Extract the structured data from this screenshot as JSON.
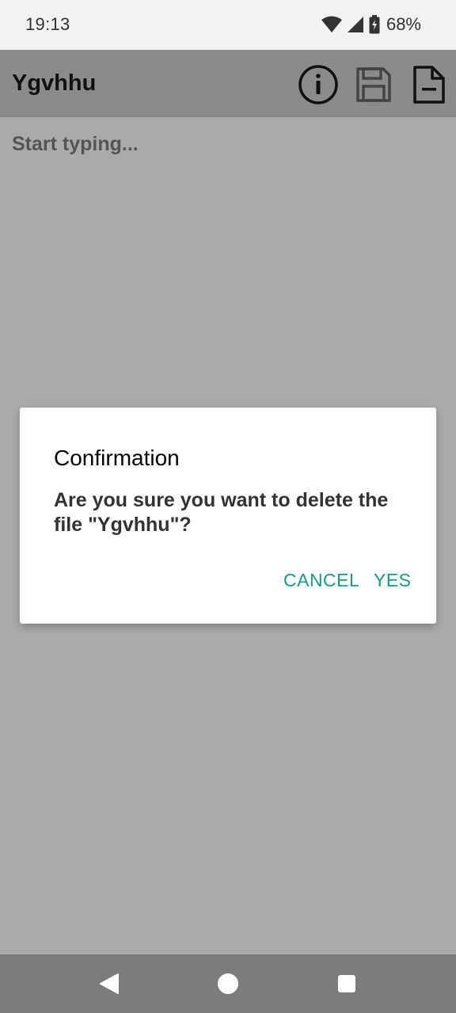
{
  "status_bar": {
    "time": "19:13",
    "battery_percent": "68%",
    "icons": [
      "wifi-icon",
      "signal-icon",
      "battery-charging-icon"
    ]
  },
  "app_bar": {
    "title": "Ygvhhu",
    "actions": [
      "info-icon",
      "save-icon",
      "delete-file-icon"
    ]
  },
  "editor": {
    "placeholder": "Start typing..."
  },
  "dialog": {
    "title": "Confirmation",
    "message": "Are you sure you want to delete the\nfile \"Ygvhhu\"?",
    "cancel_label": "CANCEL",
    "confirm_label": "YES",
    "accent_color": "#1a9986"
  },
  "nav_bar": {
    "icons": [
      "back-icon",
      "home-icon",
      "recents-icon"
    ]
  }
}
